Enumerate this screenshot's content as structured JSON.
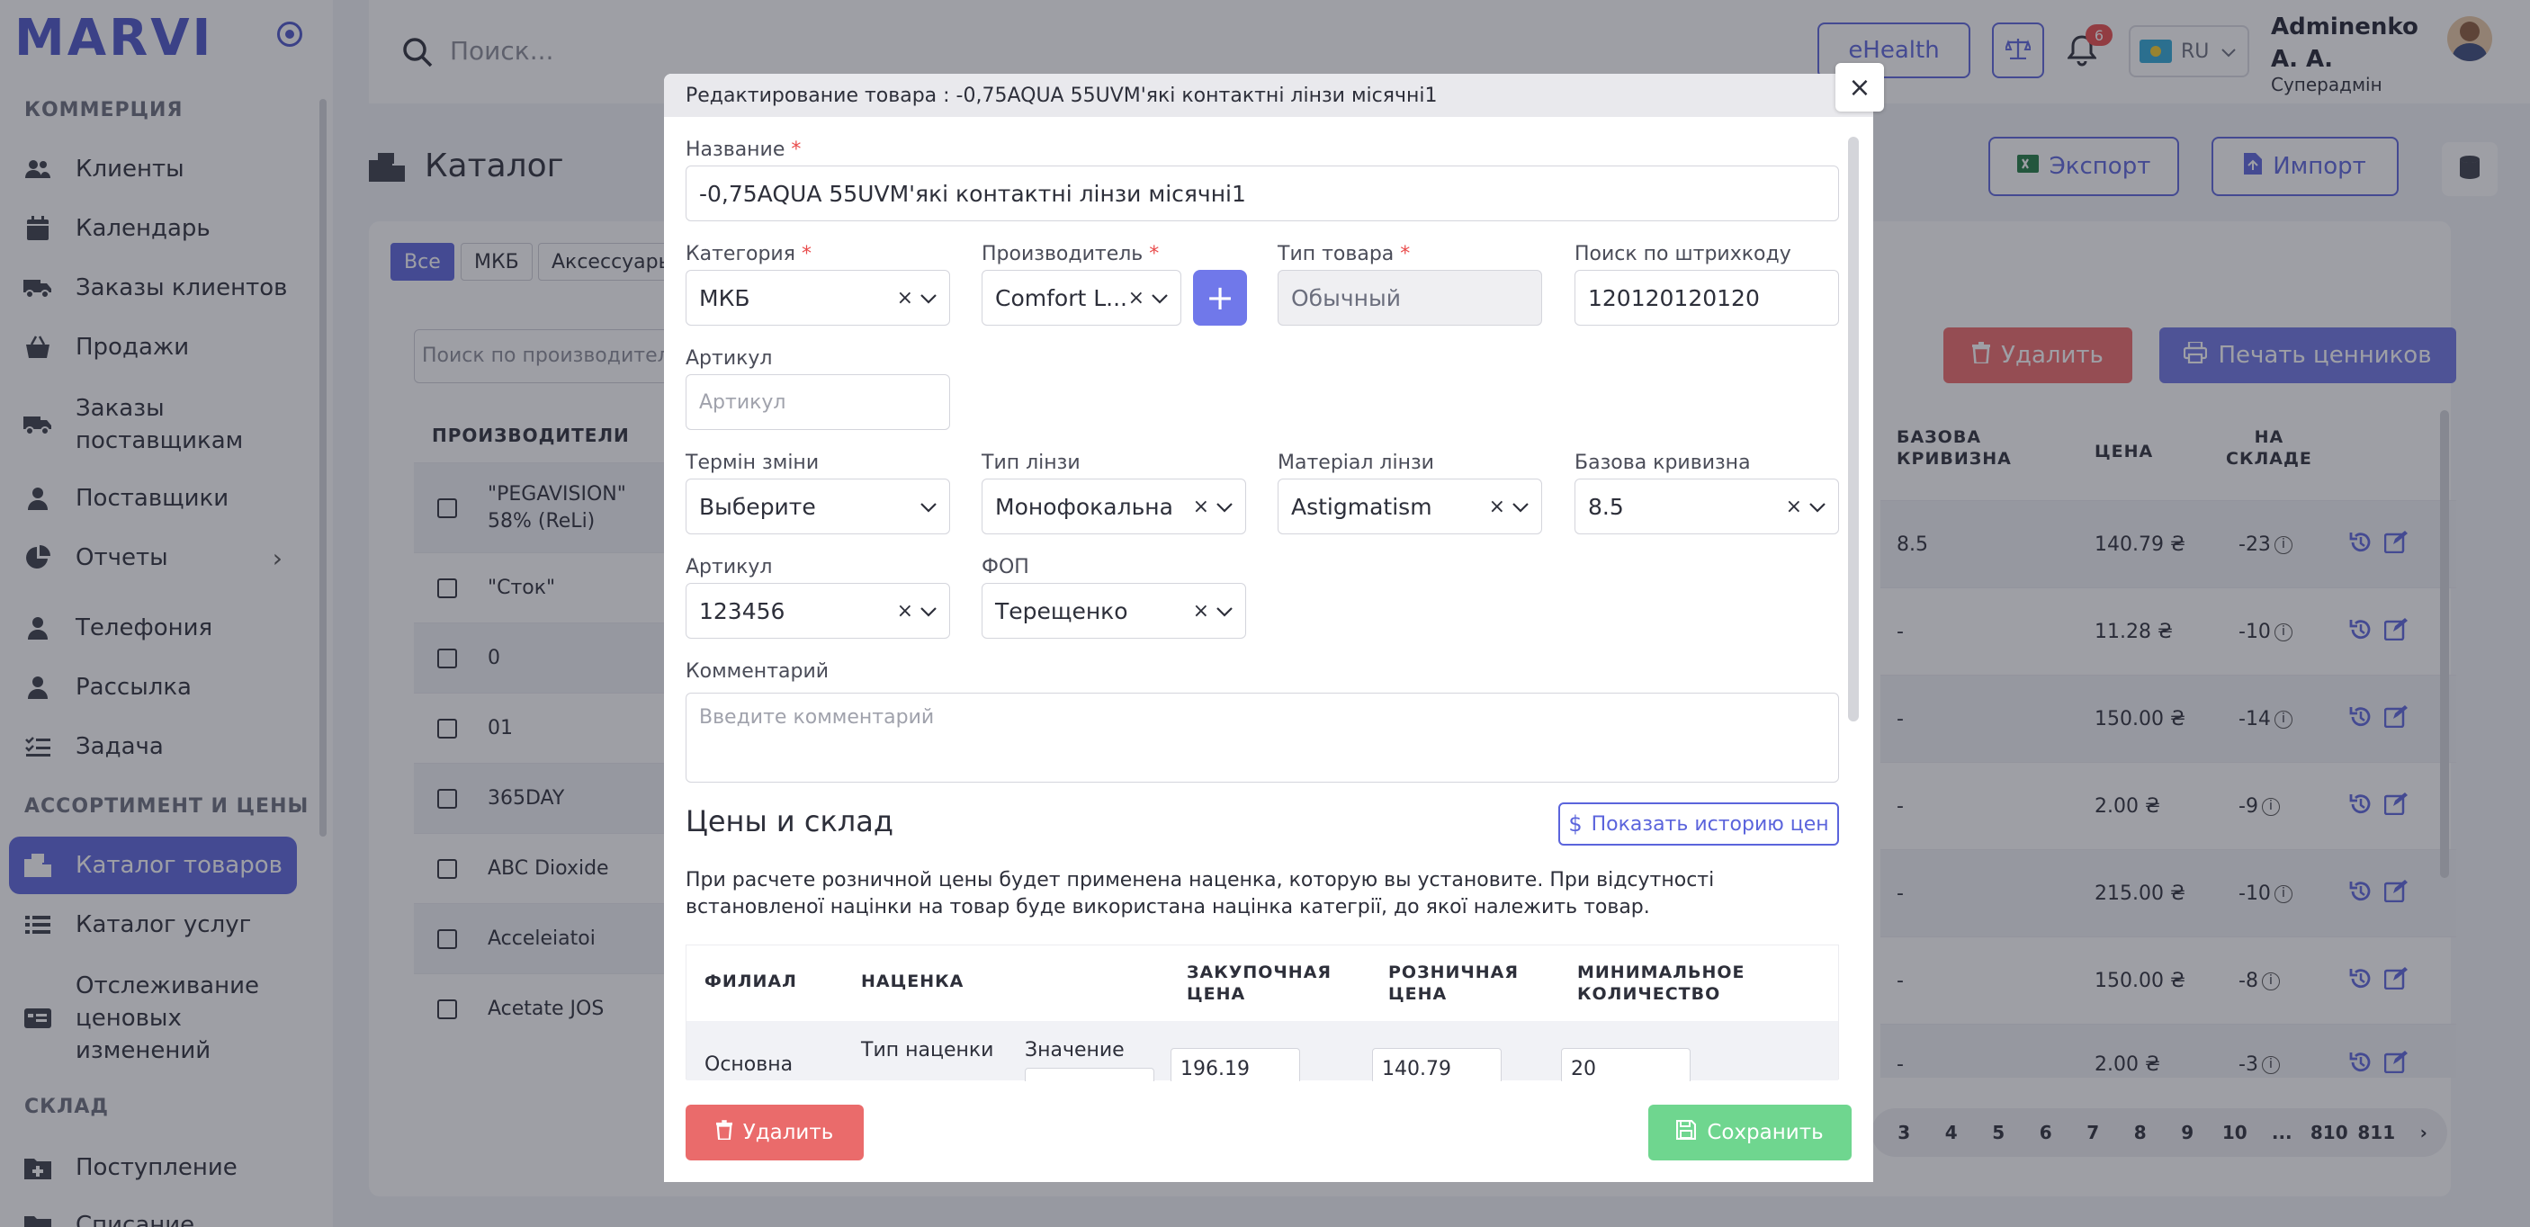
{
  "app": {
    "logo": "MARVI"
  },
  "sidebar": {
    "sections": [
      {
        "label": "КОММЕРЦИЯ"
      },
      {
        "label": "АССОРТИМЕНТ И ЦЕНЫ"
      },
      {
        "label": "СКЛАД"
      }
    ],
    "items": [
      {
        "label": "Клиенты",
        "icon": "users-icon"
      },
      {
        "label": "Календарь",
        "icon": "calendar-icon"
      },
      {
        "label": "Заказы клиентов",
        "icon": "truck-icon"
      },
      {
        "label": "Продажи",
        "icon": "basket-icon"
      },
      {
        "label": "Заказы поставщикам",
        "icon": "truck-icon"
      },
      {
        "label": "Поставщики",
        "icon": "user-icon"
      },
      {
        "label": "Отчеты",
        "icon": "pie-chart-icon"
      },
      {
        "label": "Телефония",
        "icon": "user-icon"
      },
      {
        "label": "Рассылка",
        "icon": "user-icon"
      },
      {
        "label": "Задача",
        "icon": "checklist-icon"
      },
      {
        "label": "Каталог товаров",
        "icon": "catalog-icon"
      },
      {
        "label": "Каталог услуг",
        "icon": "list-icon"
      },
      {
        "label": "Отслеживание ценовых изменений",
        "icon": "price-tag-icon"
      },
      {
        "label": "Поступление",
        "icon": "folder-plus-icon"
      },
      {
        "label": "Списание",
        "icon": "folder-icon"
      }
    ]
  },
  "topbar": {
    "search_placeholder": "Поиск...",
    "ehealth_label": "eHealth",
    "notifications_count": "6",
    "language": "RU",
    "user_name": "Adminenko А. А.",
    "user_name_line1": "Adminenko",
    "user_name_line2": "А. А.",
    "user_role": "Суперадмін"
  },
  "page": {
    "title": "Каталог",
    "export_label": "Экспорт",
    "import_label": "Импорт",
    "filter_tags": [
      "Все",
      "МКБ",
      "Аксессуары"
    ],
    "manufacturer_search_placeholder": "Поиск по производителю",
    "delete_label": "Удалить",
    "print_label": "Печать ценников",
    "manufacturers_header": "ПРОИЗВОДИТЕЛИ",
    "manufacturers": [
      "\"PEGAVISION\" 58% (ReLi)",
      "\"Сток\"",
      "0",
      "01",
      "365DAY",
      "ABC Dioxide",
      "Acceleiatoi",
      "Acetate JOS"
    ],
    "table_headers": {
      "curve_line1": "БАЗОВА",
      "curve_line2": "КРИВИЗНА",
      "price": "ЦЕНА",
      "stock_line1": "НА",
      "stock_line2": "СКЛАДЕ"
    },
    "rows": [
      {
        "curve": "8.5",
        "price": "140.79 ₴",
        "stock": "-23"
      },
      {
        "curve": "-",
        "price": "11.28 ₴",
        "stock": "-10"
      },
      {
        "curve": "-",
        "price": "150.00 ₴",
        "stock": "-14"
      },
      {
        "curve": "-",
        "price": "2.00 ₴",
        "stock": "-9"
      },
      {
        "curve": "-",
        "price": "215.00 ₴",
        "stock": "-10"
      },
      {
        "curve": "-",
        "price": "150.00 ₴",
        "stock": "-8"
      },
      {
        "curve": "-",
        "price": "2.00 ₴",
        "stock": "-3"
      }
    ],
    "pagination": [
      "3",
      "4",
      "5",
      "6",
      "7",
      "8",
      "9",
      "10",
      "...",
      "810",
      "811",
      "›"
    ]
  },
  "modal": {
    "title": "Редактирование товара : -0,75AQUA 55UVM'які контактні лінзи місячні1",
    "name_label": "Название",
    "name_value": "-0,75AQUA 55UVM'які контактні лінзи місячні1",
    "category_label": "Категория",
    "category_value": "МКБ",
    "manufacturer_label": "Производитель",
    "manufacturer_value": "Comfort L...",
    "type_label": "Тип товара",
    "type_value": "Обычный",
    "barcode_label": "Поиск по штрихкоду",
    "barcode_value": "120120120120",
    "article_label": "Артикул",
    "article_placeholder": "Артикул",
    "change_term_label": "Термін зміни",
    "change_term_value": "Выберите",
    "lens_type_label": "Тип лінзи",
    "lens_type_value": "Монофокальна",
    "lens_material_label": "Матеріал лінзи",
    "lens_material_value": "Astigmatism",
    "base_curve_label": "Базова кривизна",
    "base_curve_value": "8.5",
    "article2_label": "Артикул",
    "article2_value": "123456",
    "fop_label": "ФОП",
    "fop_value": "Терещенко",
    "comment_label": "Комментарий",
    "comment_placeholder": "Введите комментарий",
    "prices_section_title": "Цены и склад",
    "history_button": "Показать историю цен",
    "note": "При расчете розничной цены будет применена наценка, которую вы установите. При відсутності встановленої націнки на товар буде використана націнка категрії, до якої належить товар.",
    "price_table": {
      "branch_header": "ФИЛИАЛ",
      "markup_header": "НАЦЕНКА",
      "purchase_header_line1": "ЗАКУПОЧНАЯ",
      "purchase_header_line2": "ЦЕНА",
      "retail_header_line1": "РОЗНИЧНАЯ",
      "retail_header_line2": "ЦЕНА",
      "min_qty_header_line1": "МИНИМАЛЬНОЕ",
      "min_qty_header_line2": "КОЛИЧЕСТВО",
      "row": {
        "branch": "Основна",
        "markup_type_label": "Тип наценки",
        "value_label": "Значение",
        "purchase": "196.19",
        "retail": "140.79",
        "min_qty": "20"
      }
    },
    "delete_label": "Удалить",
    "save_label": "Сохранить"
  },
  "colors": {
    "accent": "#5b64dc",
    "danger": "#ea6b6b",
    "success": "#6fd68f"
  }
}
